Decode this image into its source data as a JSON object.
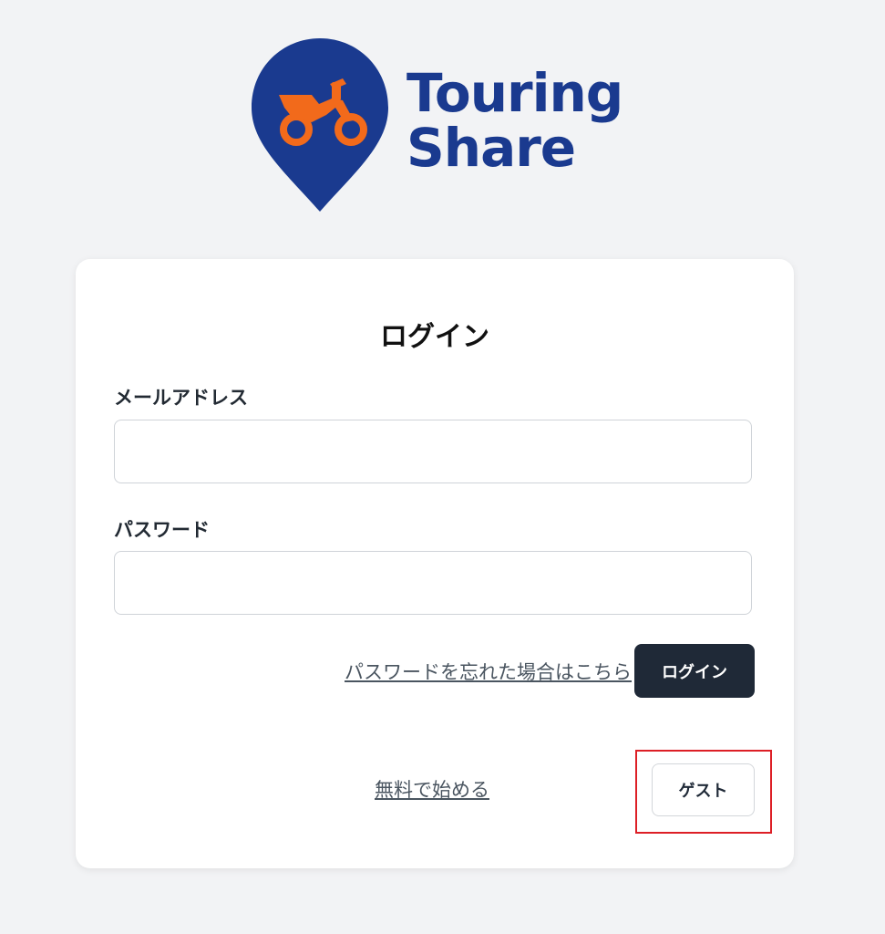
{
  "logo": {
    "line1": "Touring",
    "line2": "Share",
    "pin_color": "#1a3a8f",
    "bike_color": "#f26a1b",
    "icon": "motorcycle-pin-icon"
  },
  "login_card": {
    "title": "ログイン",
    "email_label": "メールアドレス",
    "email_value": "",
    "password_label": "パスワード",
    "password_value": "",
    "forgot_password_link": "パスワードを忘れた場合はこちら",
    "login_button": "ログイン",
    "signup_link": "無料で始める",
    "guest_button": "ゲスト"
  },
  "colors": {
    "background": "#f2f3f5",
    "primary_button": "#1f2937",
    "highlight": "#dd1f26"
  }
}
